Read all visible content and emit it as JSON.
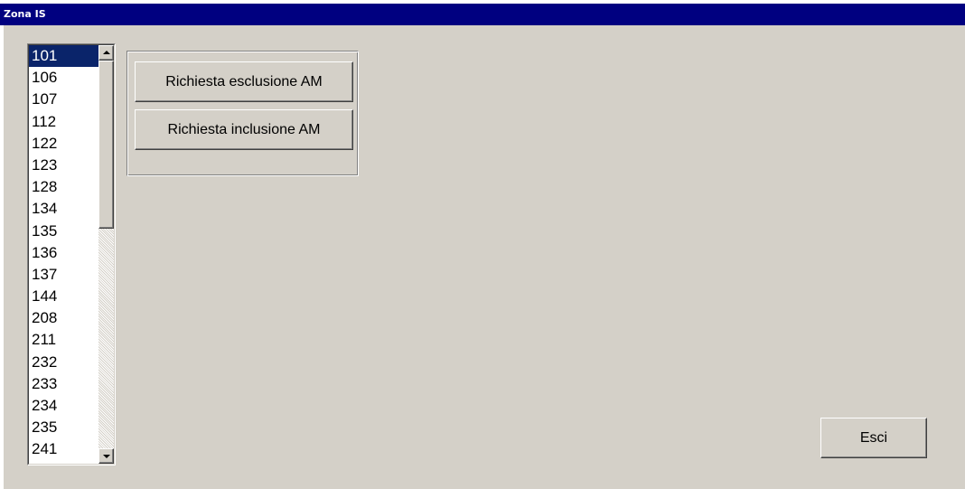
{
  "window": {
    "title": "Zona IS"
  },
  "zone_list": {
    "selected": "101",
    "items": [
      "101",
      "106",
      "107",
      "112",
      "122",
      "123",
      "128",
      "134",
      "135",
      "136",
      "137",
      "144",
      "208",
      "211",
      "232",
      "233",
      "234",
      "235",
      "241"
    ]
  },
  "actions": {
    "exclude_label": "Richiesta esclusione AM",
    "include_label": "Richiesta inclusione AM"
  },
  "footer": {
    "exit_label": "Esci"
  },
  "colors": {
    "titlebar": "#000080",
    "selection": "#0a246a",
    "face": "#d4d0c8"
  }
}
